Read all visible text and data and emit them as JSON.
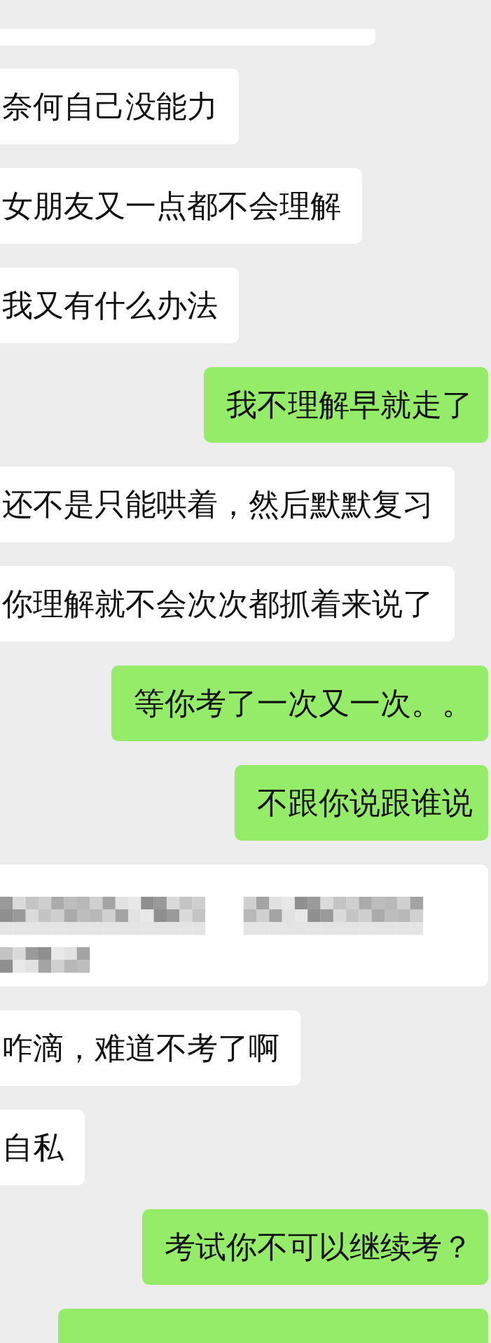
{
  "messages": [
    {
      "outgoing": false,
      "kind": "cut"
    },
    {
      "outgoing": false,
      "kind": "text",
      "text": "奈何自己没能力"
    },
    {
      "outgoing": false,
      "kind": "text",
      "text": "女朋友又一点都不会理解"
    },
    {
      "outgoing": false,
      "kind": "text",
      "text": "我又有什么办法"
    },
    {
      "outgoing": true,
      "kind": "text",
      "text": "我不理解早就走了"
    },
    {
      "outgoing": false,
      "kind": "text",
      "text": "还不是只能哄着，然后默默复习"
    },
    {
      "outgoing": false,
      "kind": "text",
      "text": "你理解就不会次次都抓着来说了"
    },
    {
      "outgoing": true,
      "kind": "text",
      "text": "等你考了一次又一次。。"
    },
    {
      "outgoing": true,
      "kind": "text",
      "text": "不跟你说跟谁说"
    },
    {
      "outgoing": false,
      "kind": "redacted"
    },
    {
      "outgoing": false,
      "kind": "text",
      "text": "咋滴，难道不考了啊"
    },
    {
      "outgoing": false,
      "kind": "text",
      "text": "自私"
    },
    {
      "outgoing": true,
      "kind": "text",
      "text": "考试你不可以继续考？"
    },
    {
      "outgoing": true,
      "kind": "cut"
    }
  ]
}
